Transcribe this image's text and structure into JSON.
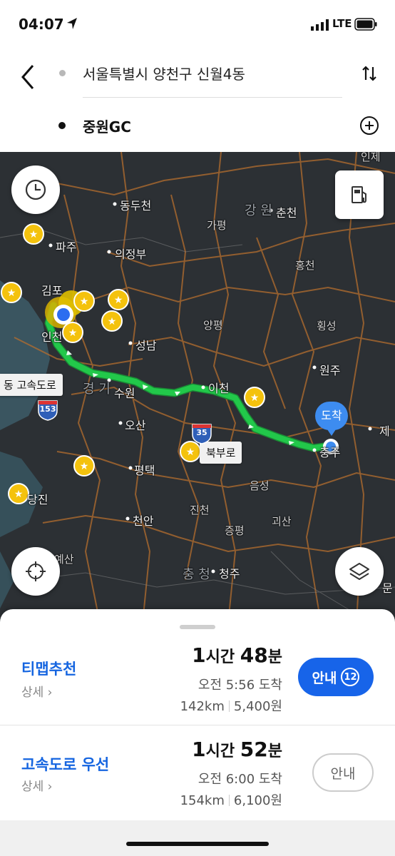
{
  "status_bar": {
    "time": "04:07",
    "network": "LTE"
  },
  "header": {
    "origin": "서울특별시 양천구 신월4동",
    "destination": "중원GC"
  },
  "map": {
    "labels": [
      {
        "text": "동두천",
        "cls": ""
      },
      {
        "text": "파주",
        "cls": ""
      },
      {
        "text": "의정부",
        "cls": ""
      },
      {
        "text": "김포",
        "cls": ""
      },
      {
        "text": "인천",
        "cls": ""
      },
      {
        "text": "성남",
        "cls": ""
      },
      {
        "text": "수원",
        "cls": ""
      },
      {
        "text": "오산",
        "cls": ""
      },
      {
        "text": "평택",
        "cls": ""
      },
      {
        "text": "천안",
        "cls": ""
      },
      {
        "text": "당진",
        "cls": ""
      },
      {
        "text": "예산",
        "cls": "small"
      },
      {
        "text": "춘천",
        "cls": ""
      },
      {
        "text": "가평",
        "cls": "small"
      },
      {
        "text": "홍천",
        "cls": "small"
      },
      {
        "text": "양평",
        "cls": "small"
      },
      {
        "text": "횡성",
        "cls": "small"
      },
      {
        "text": "원주",
        "cls": ""
      },
      {
        "text": "이천",
        "cls": ""
      },
      {
        "text": "충주",
        "cls": ""
      },
      {
        "text": "음성",
        "cls": "small"
      },
      {
        "text": "진천",
        "cls": "small"
      },
      {
        "text": "괴산",
        "cls": "small"
      },
      {
        "text": "증평",
        "cls": "small"
      },
      {
        "text": "청주",
        "cls": ""
      },
      {
        "text": "인제",
        "cls": "small"
      },
      {
        "text": "제",
        "cls": ""
      },
      {
        "text": "문",
        "cls": ""
      },
      {
        "text": "강 원",
        "cls": "big"
      },
      {
        "text": "경 기",
        "cls": "big"
      },
      {
        "text": "충 청",
        "cls": "big"
      }
    ],
    "road_tags": [
      "동 고속도로",
      "북부로"
    ],
    "highway_shields": [
      "153",
      "35"
    ],
    "destination_pin": "도착",
    "route_color": "#22c84a",
    "origin_color": "#2b6df0"
  },
  "routes": [
    {
      "name": "티맵추천",
      "detail": "상세",
      "duration_hours": "1",
      "duration_hours_unit": "시간",
      "duration_minutes": "48",
      "duration_minutes_unit": "분",
      "arrival": "오전 5:56 도착",
      "distance": "142km",
      "toll": "5,400원",
      "button": "안내",
      "countdown": "12"
    },
    {
      "name": "고속도로 우선",
      "detail": "상세",
      "duration_hours": "1",
      "duration_hours_unit": "시간",
      "duration_minutes": "52",
      "duration_minutes_unit": "분",
      "arrival": "오전 6:00 도착",
      "distance": "154km",
      "toll": "6,100원",
      "button": "안내"
    }
  ]
}
